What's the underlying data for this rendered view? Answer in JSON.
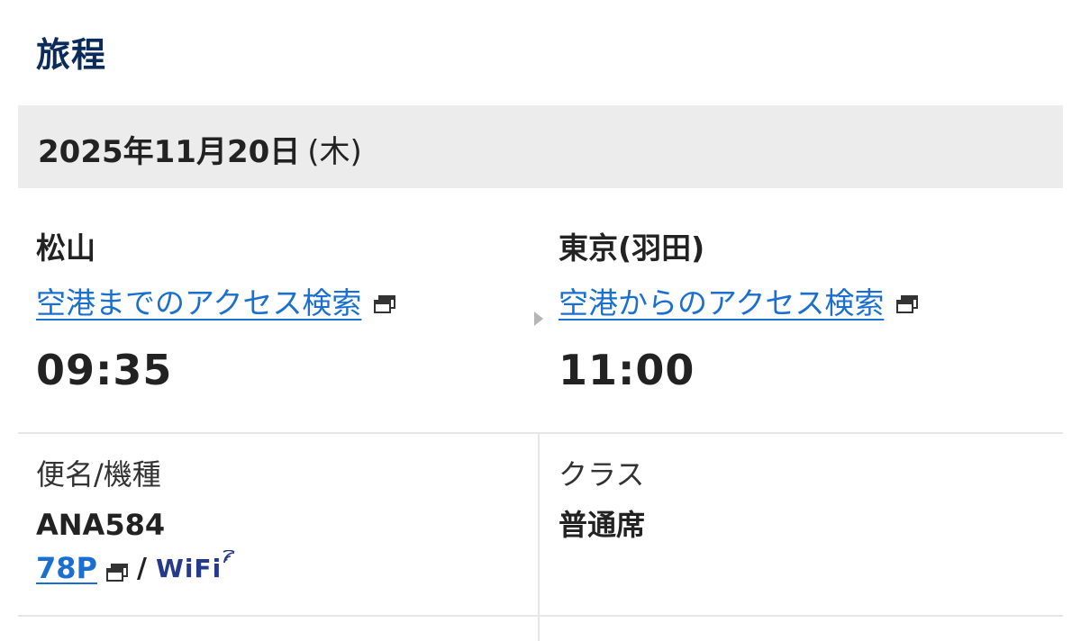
{
  "itinerary": {
    "title": "旅程",
    "date": "2025年11月20日",
    "day_of_week": "(木)"
  },
  "departure": {
    "airport": "松山",
    "access_link": "空港までのアクセス検索",
    "time": "09:35"
  },
  "arrival": {
    "airport": "東京(羽田)",
    "access_link": "空港からのアクセス検索",
    "time": "11:00"
  },
  "flight": {
    "label": "便名/機種",
    "number": "ANA584",
    "aircraft": "78P",
    "separator": "/",
    "wifi": "WiFi"
  },
  "class": {
    "label": "クラス",
    "value": "普通席"
  },
  "colors": {
    "title": "#0b2c5a",
    "link": "#1a6fd1",
    "wifi": "#253a8a",
    "date_bar": "#ececec"
  },
  "icons": {
    "external_window": "external-window-icon",
    "arrow": "chevron-right-icon",
    "wifi_signal": "wifi-signal-icon"
  }
}
